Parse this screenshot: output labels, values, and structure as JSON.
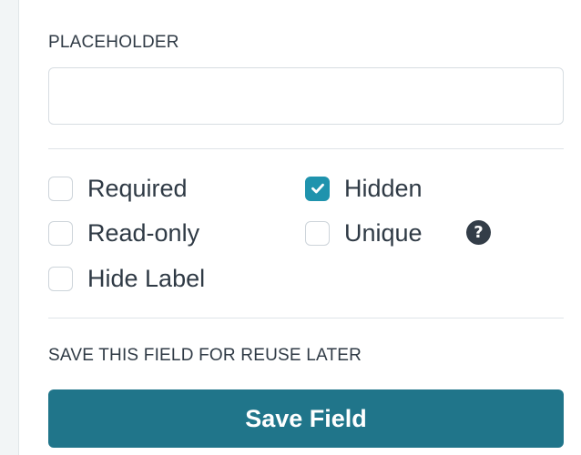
{
  "placeholder": {
    "label": "PLACEHOLDER",
    "value": ""
  },
  "options": {
    "required": {
      "label": "Required",
      "checked": false
    },
    "hidden": {
      "label": "Hidden",
      "checked": true
    },
    "readonly": {
      "label": "Read-only",
      "checked": false
    },
    "unique": {
      "label": "Unique",
      "checked": false
    },
    "hide_label": {
      "label": "Hide Label",
      "checked": false
    },
    "help_glyph": "?"
  },
  "save": {
    "section_label": "SAVE THIS FIELD FOR REUSE LATER",
    "button_label": "Save Field"
  },
  "colors": {
    "accent": "#1f93ad",
    "button": "#20758a"
  }
}
